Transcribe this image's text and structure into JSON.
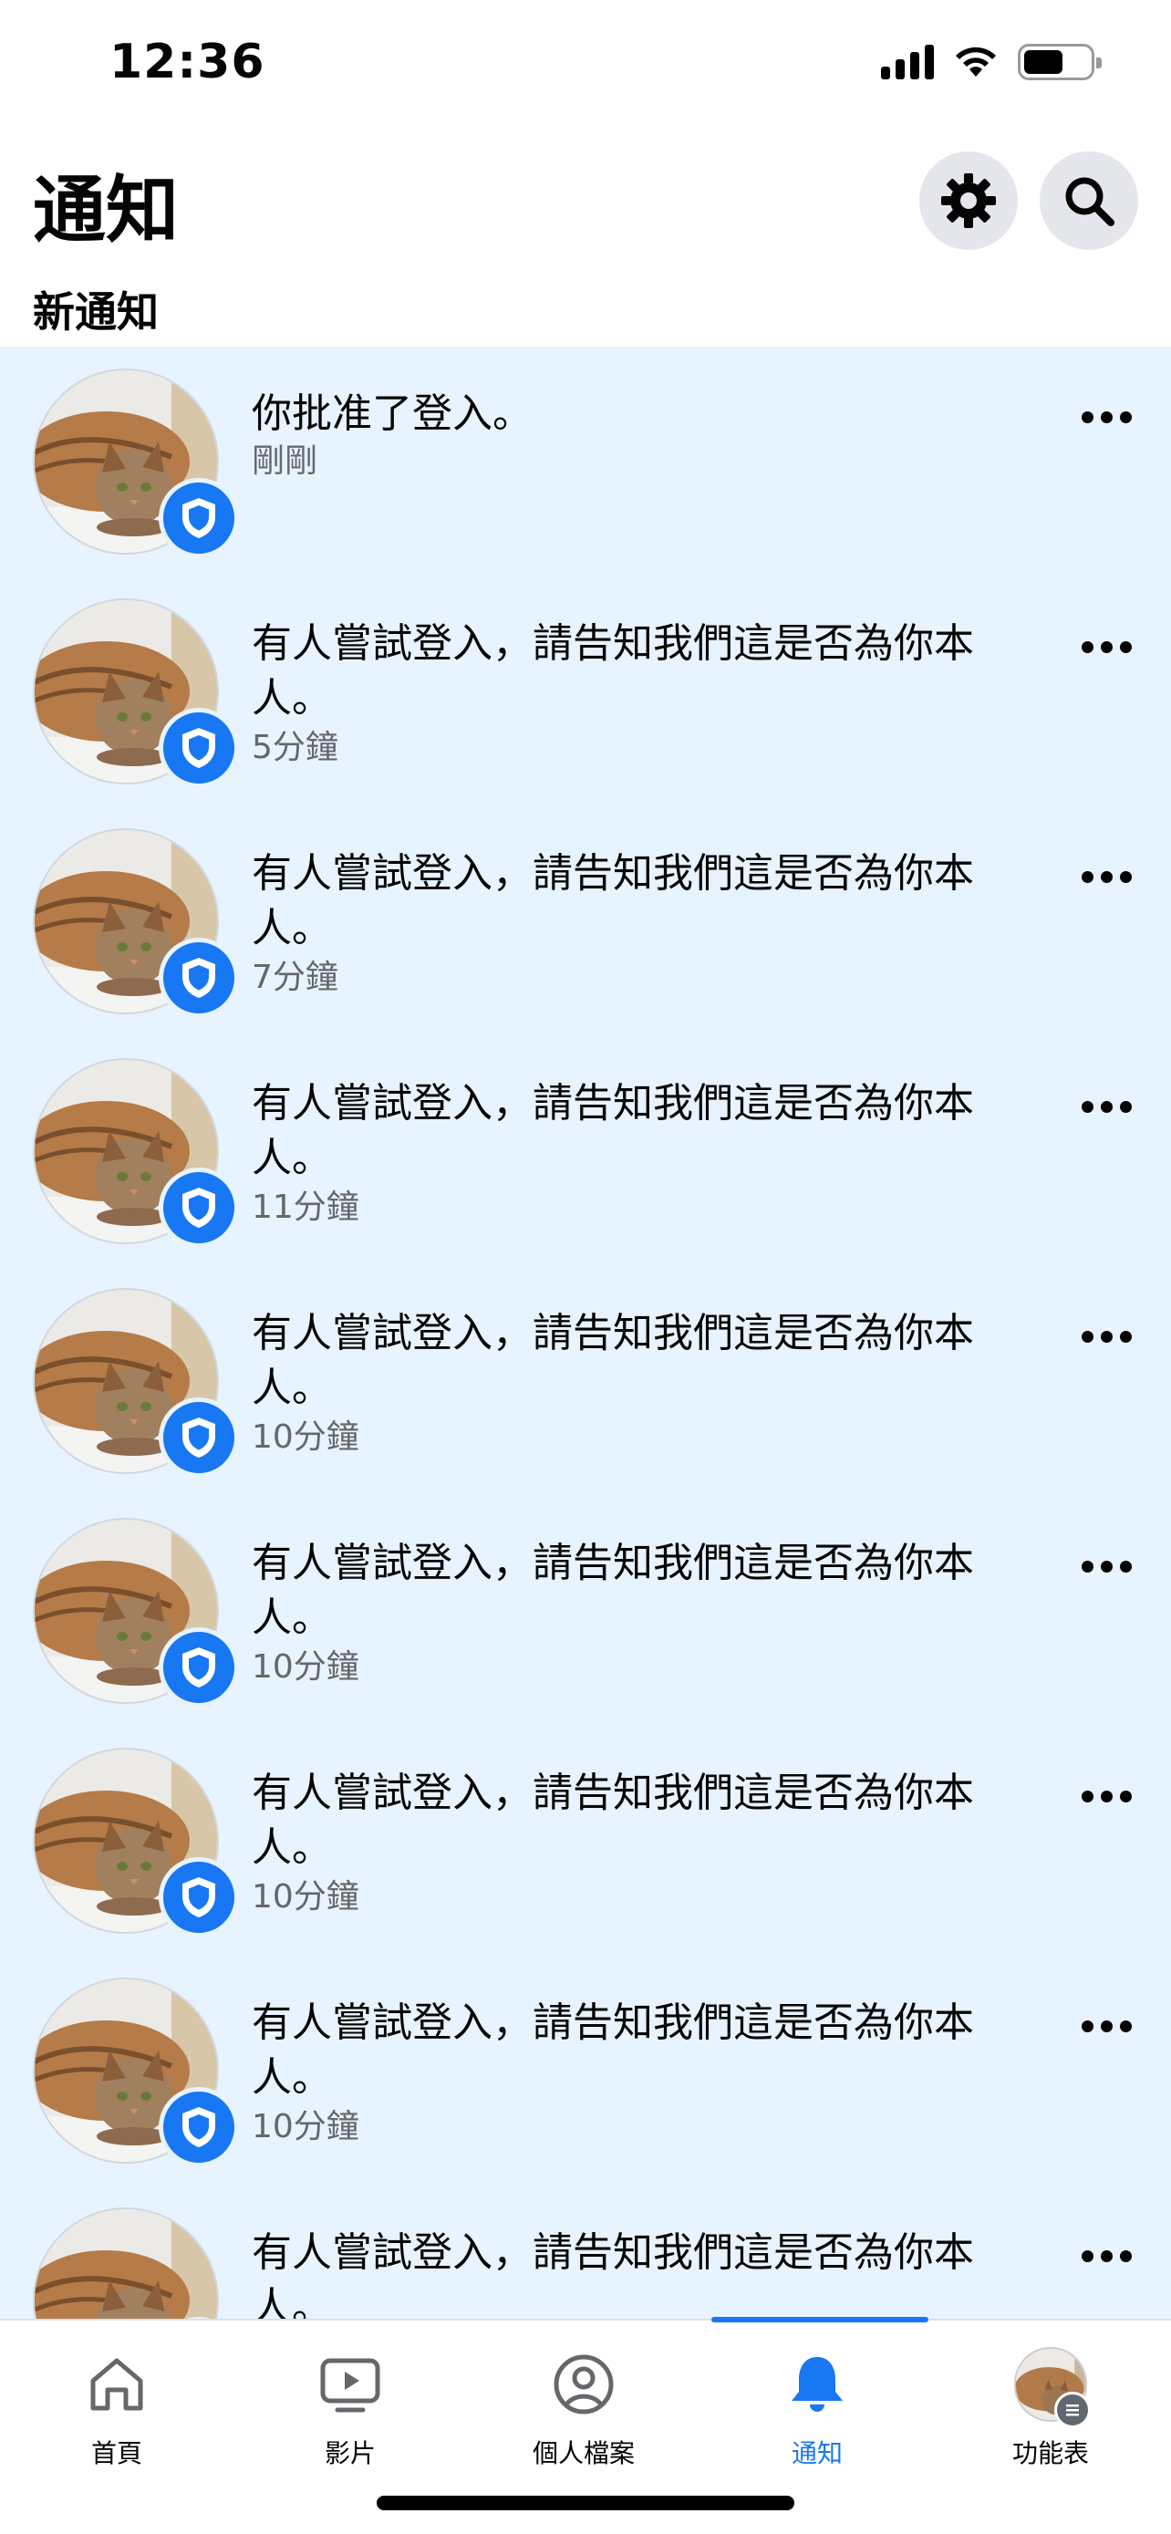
{
  "status_bar": {
    "time": "12:36"
  },
  "header": {
    "title": "通知",
    "settings_icon": "gear-icon",
    "search_icon": "search-icon"
  },
  "section": {
    "title": "新通知"
  },
  "notifications": [
    {
      "text": "你批准了登入。",
      "time": "剛剛",
      "badge_icon": "shield-icon"
    },
    {
      "text": "有人嘗試登入，請告知我們這是否為你本人。",
      "time": "5分鐘",
      "badge_icon": "shield-icon"
    },
    {
      "text": "有人嘗試登入，請告知我們這是否為你本人。",
      "time": "7分鐘",
      "badge_icon": "shield-icon"
    },
    {
      "text": "有人嘗試登入，請告知我們這是否為你本人。",
      "time": "11分鐘",
      "badge_icon": "shield-icon"
    },
    {
      "text": "有人嘗試登入，請告知我們這是否為你本人。",
      "time": "10分鐘",
      "badge_icon": "shield-icon"
    },
    {
      "text": "有人嘗試登入，請告知我們這是否為你本人。",
      "time": "10分鐘",
      "badge_icon": "shield-icon"
    },
    {
      "text": "有人嘗試登入，請告知我們這是否為你本人。",
      "time": "10分鐘",
      "badge_icon": "shield-icon"
    },
    {
      "text": "有人嘗試登入，請告知我們這是否為你本人。",
      "time": "10分鐘",
      "badge_icon": "shield-icon"
    },
    {
      "text": "有人嘗試登入，請告知我們這是否為你本人。",
      "time": "",
      "badge_icon": "shield-icon"
    }
  ],
  "tabs": [
    {
      "label": "首頁",
      "icon": "home-icon"
    },
    {
      "label": "影片",
      "icon": "video-icon"
    },
    {
      "label": "個人檔案",
      "icon": "profile-icon"
    },
    {
      "label": "通知",
      "icon": "bell-icon",
      "active": true
    },
    {
      "label": "功能表",
      "icon": "menu-icon"
    }
  ],
  "colors": {
    "accent": "#1877f2",
    "unread_bg": "#e7f3ff",
    "muted_text": "#65676b"
  }
}
